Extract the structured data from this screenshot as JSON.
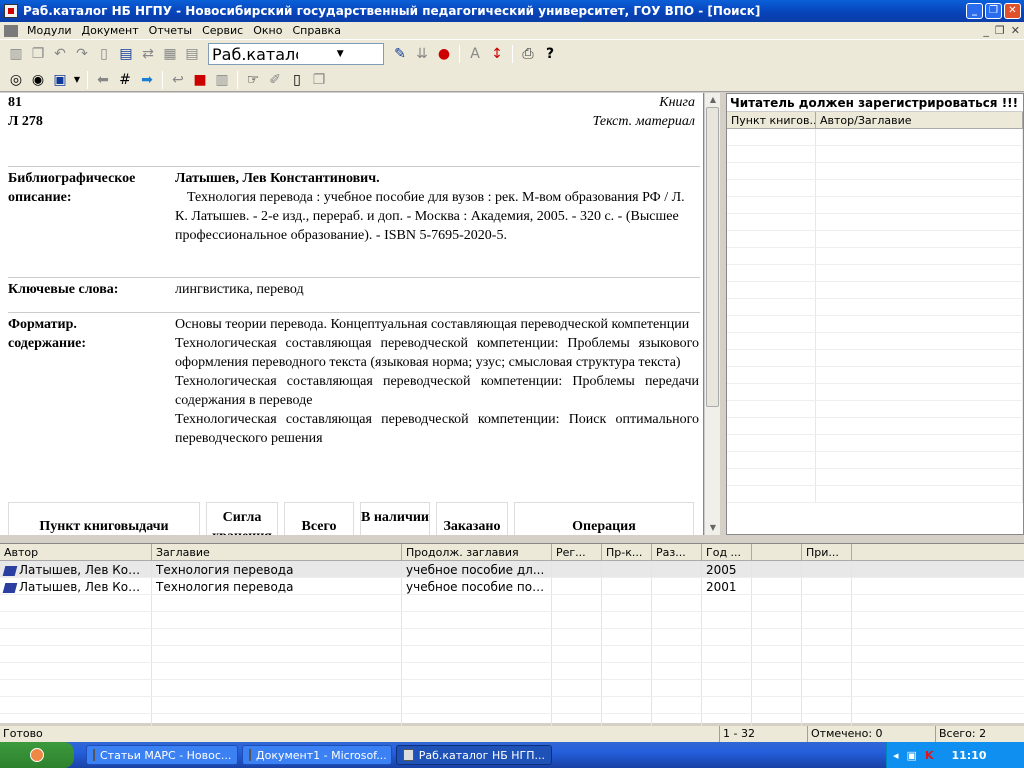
{
  "window": {
    "title": "Раб.каталог НБ НГПУ - Новосибирский государственный педагогический университет, ГОУ ВПО - [Поиск]"
  },
  "menu": [
    "Модули",
    "Документ",
    "Отчеты",
    "Сервис",
    "Окно",
    "Справка"
  ],
  "toolbar": {
    "catalog_select": "Раб.каталог НБ НГПУ"
  },
  "doc": {
    "code1": "81",
    "code2": "Л 278",
    "type1": "Книга",
    "type2": "Текст. материал",
    "bib_label_1": "Библиографическое",
    "bib_label_2": "описание:",
    "author": "Латышев, Лев Константинович.",
    "bib_text": "Технология перевода : учебное пособие для вузов : рек. М-вом образования РФ / Л. К. Латышев. - 2-е изд., перераб. и доп. - Москва : Академия, 2005. - 320 с. - (Высшее профессиональное образование). - ISBN 5-7695-2020-5.",
    "kw_label": "Ключевые слова:",
    "kw_value": "лингвистика, перевод",
    "fmt_label_1": "Форматир.",
    "fmt_label_2": "содержание:",
    "contents": [
      "Основы теории перевода. Концептуальная составляющая переводческой компетенции",
      "Технологическая составляющая переводческой компетенции: Проблемы языкового оформления переводного текста (языковая норма; узус; смысловая структура текста)",
      "Технологическая составляющая переводческой компетенции: Проблемы передачи содержания в переводе",
      "Технологическая составляющая переводческой компетенции: Поиск оптимального переводческого решения"
    ],
    "stock_headers": [
      "Пункт книговыдачи",
      "Сигла хранения",
      "Всего",
      "В наличии",
      "Заказано",
      "Операция"
    ]
  },
  "reader": {
    "title": "Читатель должен зарегистрироваться !!!",
    "columns": [
      "Пункт книгов...",
      "Автор/Заглавие"
    ]
  },
  "results": {
    "columns": [
      "Автор",
      "Заглавие",
      "Продолж. заглавия",
      "Рег...",
      "Пр-к...",
      "Раз...",
      "Год ...",
      "",
      "При..."
    ],
    "rows": [
      [
        "Латышев, Лев Кон...",
        "Технология перевода",
        "учебное пособие дл...",
        "",
        "",
        "",
        "2005",
        "",
        ""
      ],
      [
        "Латышев, Лев Кон...",
        "Технология перевода",
        "учебное пособие по ...",
        "",
        "",
        "",
        "2001",
        "",
        ""
      ]
    ]
  },
  "status": {
    "ready": "Готово",
    "range": "1 - 32",
    "marked": "Отмечено: 0",
    "total": "Всего: 2"
  },
  "taskbar": {
    "tasks": [
      "Статьи МАРС - Новос...",
      "Документ1 - Microsof...",
      "Раб.каталог НБ НГП..."
    ],
    "lang": "RU",
    "time": "11:10"
  }
}
